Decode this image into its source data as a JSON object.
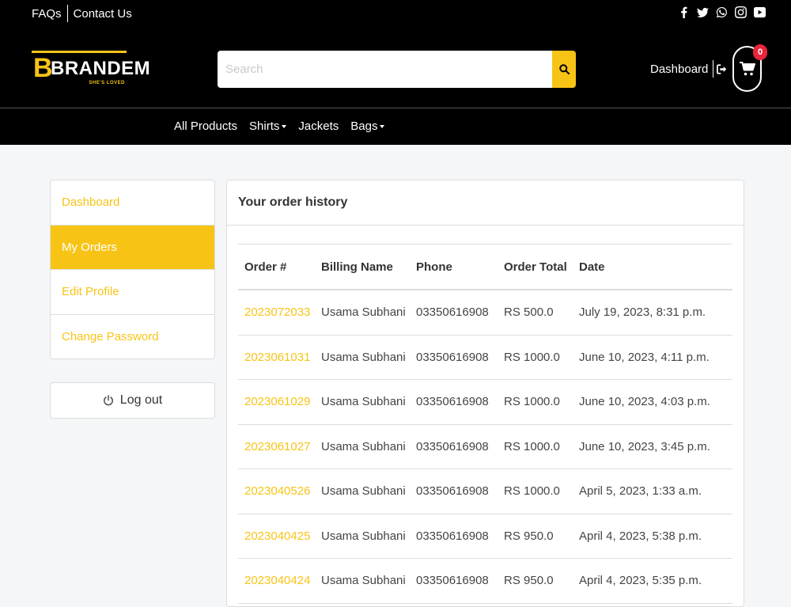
{
  "toplinks": {
    "faqs": "FAQs",
    "contact": "Contact Us"
  },
  "social": [
    {
      "icon": "facebook-icon"
    },
    {
      "icon": "twitter-icon"
    },
    {
      "icon": "whatsapp-icon"
    },
    {
      "icon": "instagram-icon"
    },
    {
      "icon": "youtube-icon"
    }
  ],
  "brand": {
    "initial": "B",
    "name": "BRANDEM",
    "tagline": "SHE'S LOVED",
    "accent": "#f7c416"
  },
  "search": {
    "placeholder": "Search"
  },
  "header": {
    "dashboard_label": "Dashboard",
    "cart_count": "0"
  },
  "nav": {
    "all_products": "All Products",
    "shirts": "Shirts",
    "jackets": "Jackets",
    "bags": "Bags"
  },
  "sidebar": {
    "items": [
      {
        "label": "Dashboard",
        "active": false
      },
      {
        "label": "My Orders",
        "active": true
      },
      {
        "label": "Edit Profile",
        "active": false
      },
      {
        "label": "Change Password",
        "active": false
      }
    ],
    "logout_label": "Log out"
  },
  "orders": {
    "title": "Your order history",
    "columns": {
      "order": "Order #",
      "billing": "Billing Name",
      "phone": "Phone",
      "total": "Order Total",
      "date": "Date"
    },
    "rows": [
      {
        "order": "2023072033",
        "name": "Usama Subhani",
        "phone": "03350616908",
        "total": "RS 500.0",
        "date": "July 19, 2023, 8:31 p.m."
      },
      {
        "order": "2023061031",
        "name": "Usama Subhani",
        "phone": "03350616908",
        "total": "RS 1000.0",
        "date": "June 10, 2023, 4:11 p.m."
      },
      {
        "order": "2023061029",
        "name": "Usama Subhani",
        "phone": "03350616908",
        "total": "RS 1000.0",
        "date": "June 10, 2023, 4:03 p.m."
      },
      {
        "order": "2023061027",
        "name": "Usama Subhani",
        "phone": "03350616908",
        "total": "RS 1000.0",
        "date": "June 10, 2023, 3:45 p.m."
      },
      {
        "order": "2023040526",
        "name": "Usama Subhani",
        "phone": "03350616908",
        "total": "RS 1000.0",
        "date": "April 5, 2023, 1:33 a.m."
      },
      {
        "order": "2023040425",
        "name": "Usama Subhani",
        "phone": "03350616908",
        "total": "RS 950.0",
        "date": "April 4, 2023, 5:38 p.m."
      },
      {
        "order": "2023040424",
        "name": "Usama Subhani",
        "phone": "03350616908",
        "total": "RS 950.0",
        "date": "April 4, 2023, 5:35 p.m."
      }
    ]
  }
}
